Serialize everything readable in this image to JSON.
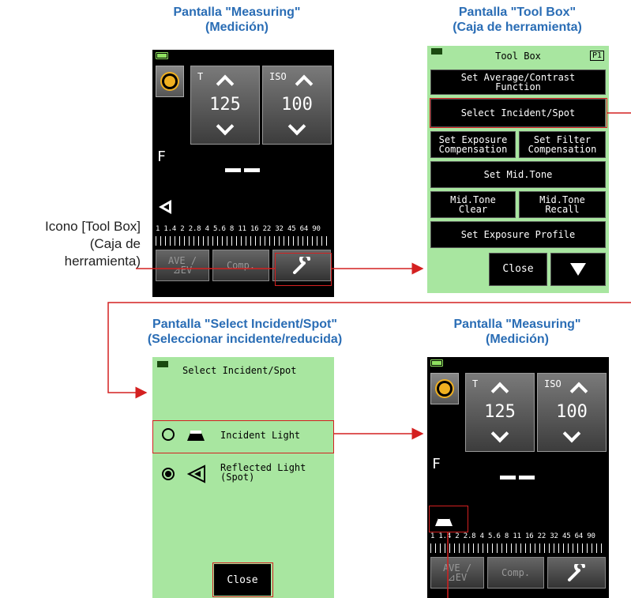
{
  "captions": {
    "top_left": "Pantalla \"Measuring\"\n(Medición)",
    "top_right": "Pantalla \"Tool Box\"\n(Caja de herramienta)",
    "bottom_left": "Pantalla \"Select Incident/Spot\"\n(Seleccionar incidente/reducida)",
    "bottom_right": "Pantalla \"Measuring\"\n(Medición)"
  },
  "side_label": "Icono [Tool Box]\n(Caja de\nherramienta)",
  "measuring": {
    "t_label": "T",
    "t_value": "125",
    "iso_label": "ISO",
    "iso_value": "100",
    "f_label": "F",
    "scale": "1  1.4 2  2.8 4 5.6 8  11 16 22 32 45 64 90",
    "ave_btn": "AVE /\n⊿EV",
    "comp_btn": "Comp."
  },
  "toolbox": {
    "title": "Tool Box",
    "page": "P1",
    "items": [
      "Set Average/Contrast\nFunction",
      "Select Incident/Spot",
      "Set Exposure\nCompensation",
      "Set Filter\nCompensation",
      "Set Mid.Tone",
      "Mid.Tone\nClear",
      "Mid.Tone\nRecall",
      "Set Exposure Profile"
    ],
    "close": "Close"
  },
  "select": {
    "title": "Select Incident/Spot",
    "option1": "Incident Light",
    "option2": "Reflected Light\n (Spot)",
    "close": "Close"
  },
  "colors": {
    "caption": "#2a6db5",
    "highlight": "#d42020",
    "screen_green": "#a8e6a0"
  }
}
